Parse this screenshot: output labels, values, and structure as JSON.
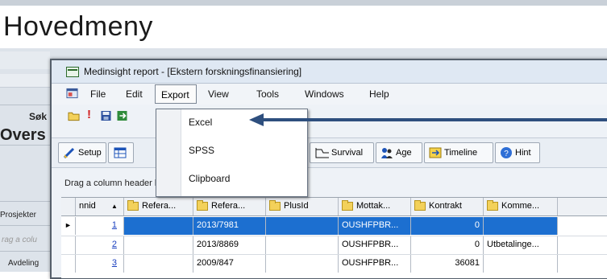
{
  "page_heading": "Hovedmeny",
  "background_app": {
    "sok_label": "Søk",
    "oversikt_label": "Overs",
    "prosjekter_label": "Prosjekter",
    "grouping_hint_fragment": "rag a colu",
    "avdeling_label": "Avdeling"
  },
  "window": {
    "title": "Medinsight report - [Ekstern forskningsfinansiering]",
    "menu": {
      "file": "File",
      "edit": "Edit",
      "export": "Export",
      "view": "View",
      "tools": "Tools",
      "windows": "Windows",
      "help": "Help"
    },
    "export_menu": {
      "items": [
        "Excel",
        "SPSS",
        "Clipboard"
      ]
    },
    "tabs": {
      "setup": "Setup",
      "survival": "Survival",
      "age": "Age",
      "timeline": "Timeline",
      "hint": "Hint"
    },
    "grouping_hint": "Drag a column header here to group by that column",
    "grid": {
      "columns": [
        "nnid",
        "Refera...",
        "Refera...",
        "PlusId",
        "Mottak...",
        "Kontrakt",
        "Komme..."
      ],
      "rows": [
        {
          "nnid": "1",
          "ref1": "",
          "ref2": "2013/7981",
          "plusid": "",
          "mottak": "OUSHFPBR...",
          "kontrakt": "0",
          "komme": ""
        },
        {
          "nnid": "2",
          "ref1": "",
          "ref2": "2013/8869",
          "plusid": "",
          "mottak": "OUSHFPBR...",
          "kontrakt": "0",
          "komme": "Utbetalinge..."
        },
        {
          "nnid": "3",
          "ref1": "",
          "ref2": "2009/847",
          "plusid": "",
          "mottak": "OUSHFPBR...",
          "kontrakt": "36081",
          "komme": ""
        }
      ],
      "selected_row": 0
    }
  },
  "colors": {
    "selection": "#1c6fd0",
    "arrow": "#2e4f7e",
    "folder": "#f3d15a"
  }
}
